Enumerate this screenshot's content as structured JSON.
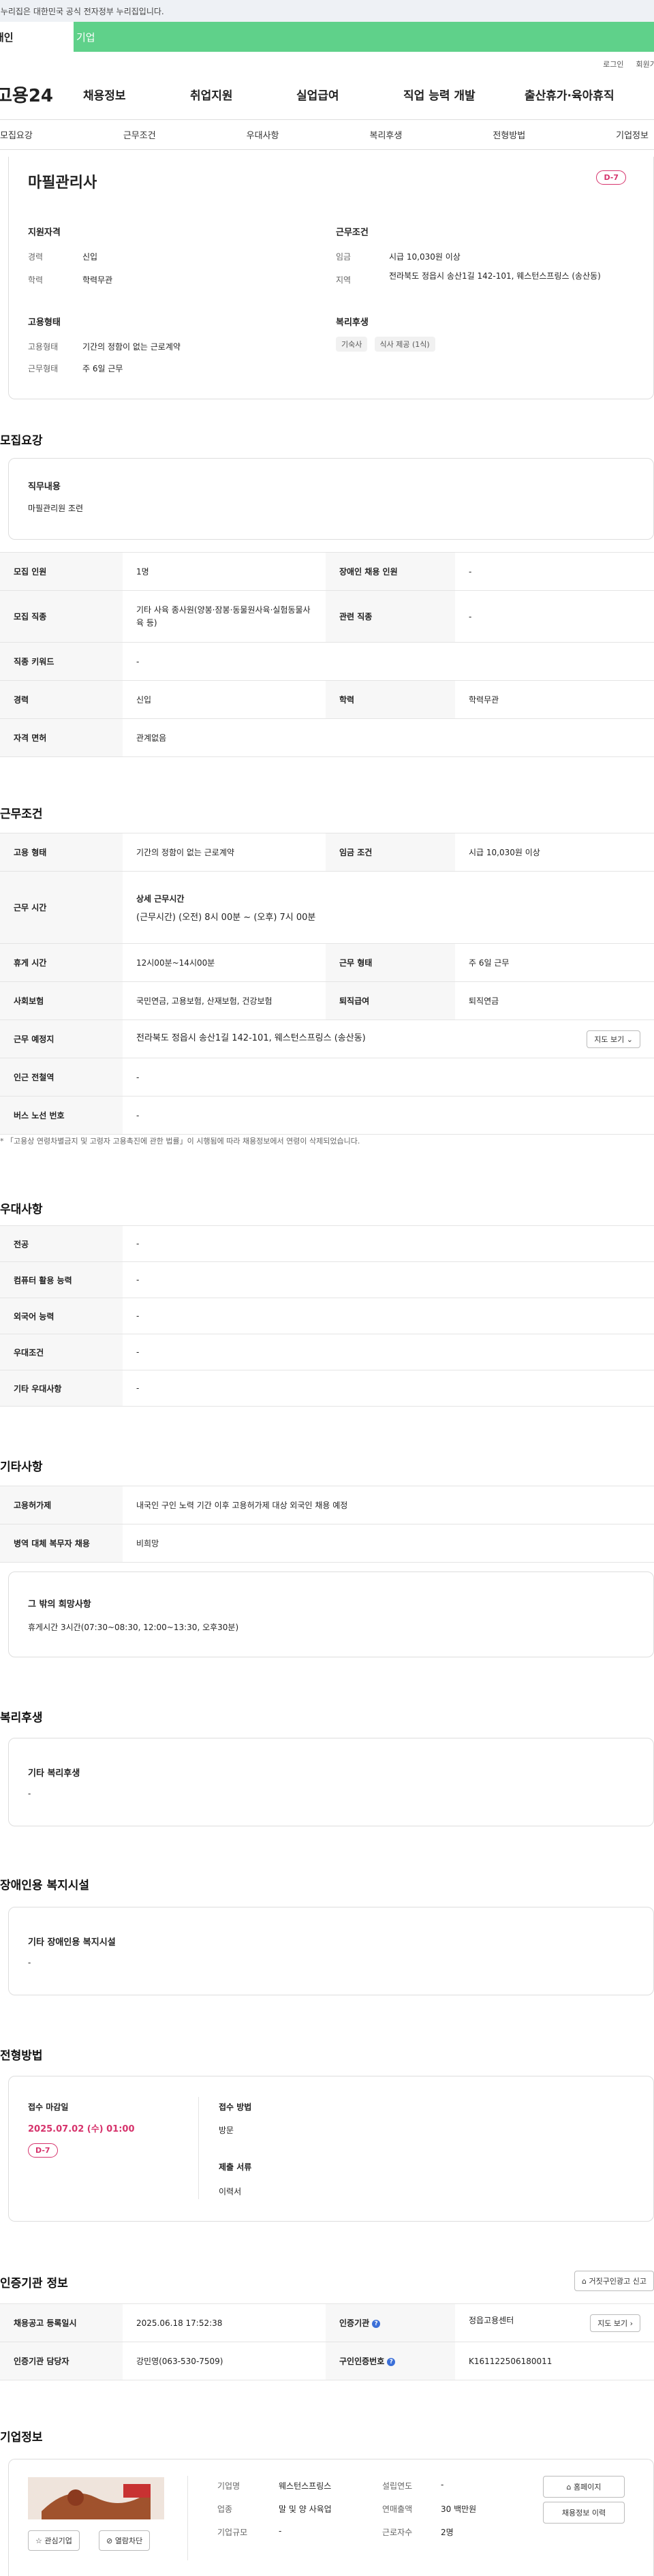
{
  "gov_notice": "이 누리집은 대한민국 공식 전자정부 누리집입니다.",
  "top_tabs": {
    "individual": "개인",
    "corporate": "기업"
  },
  "util": {
    "login": "로그인",
    "join": "회원가입"
  },
  "gnb": {
    "logo": "고용24",
    "menus": [
      "채용정보",
      "취업지원",
      "실업급여",
      "직업 능력 개발",
      "출산휴가·육아휴직"
    ]
  },
  "subnav": [
    "모집요강",
    "근무조건",
    "우대사항",
    "복리후생",
    "전형방법",
    "기업정보"
  ],
  "summary": {
    "title": "마필관리사",
    "dday": "D-7",
    "qualification_title": "지원자격",
    "career_label": "경력",
    "career_value": "신입",
    "education_label": "학력",
    "education_value": "학력무관",
    "employment_title": "고용형태",
    "emp_type_label": "고용형태",
    "emp_type_value": "기간의 정함이 없는 근로계약",
    "work_type_label": "근무형태",
    "work_type_value": "주 6일 근무",
    "conditions_title": "근무조건",
    "wage_label": "임금",
    "wage_value": "시급 10,030원 이상",
    "region_label": "지역",
    "region_value": "전라북도 정읍시 송산1길 142-101, 웨스턴스프링스 (송산동)",
    "welfare_title": "복리후생",
    "welfare_chips": [
      "기숙사",
      "식사 제공 (1식)"
    ]
  },
  "recruit": {
    "title": "모집요강",
    "duty_label": "직무내용",
    "duty_value": "마필관리원 조련",
    "rows": [
      {
        "l1": "모집 인원",
        "v1": "1명",
        "l2": "장애인 채용 인원",
        "v2": "-"
      },
      {
        "l1": "모집 직종",
        "v1": "기타 사육 종사원(양봉·잠봉·동물원사육·실험동물사육 등)",
        "l2": "관련 직종",
        "v2": "-"
      },
      {
        "l1": "직종 키워드",
        "v1": "-",
        "l2": "",
        "v2": ""
      },
      {
        "l1": "경력",
        "v1": "신입",
        "l2": "학력",
        "v2": "학력무관"
      },
      {
        "l1": "자격 면허",
        "v1": "관계없음",
        "l2": "",
        "v2": ""
      }
    ]
  },
  "work": {
    "title": "근무조건",
    "emp_label": "고용 형태",
    "emp_value": "기간의 정함이 없는 근로계약",
    "wage_label": "임금 조건",
    "wage_value": "시급 10,030원 이상",
    "time_label": "근무 시간",
    "time_sub": "상세 근무시간",
    "time_value": "(근무시간) (오전) 8시 00분 ~ (오후) 7시 00분",
    "rest_label": "휴게 시간",
    "rest_value": "12시00분~14시00분",
    "type_label": "근무 형태",
    "type_value": "주 6일 근무",
    "ins_label": "사회보험",
    "ins_value": "국민연금, 고용보험, 산재보험, 건강보험",
    "sev_label": "퇴직급여",
    "sev_value": "퇴직연금",
    "place_label": "근무 예정지",
    "place_value": "전라북도 정읍시 송산1길 142-101, 웨스턴스프링스 (송산동)",
    "map_button": "지도 보기",
    "subway_label": "인근 전철역",
    "subway_value": "-",
    "bus_label": "버스 노선 번호",
    "bus_value": "-",
    "note": "「고용상 연령차별금지 및 고령자 고용촉진에 관한 법률」이 시행됨에 따라 채용정보에서 연령이 삭제되었습니다."
  },
  "pref": {
    "title": "우대사항",
    "rows": [
      {
        "label": "전공",
        "value": "-"
      },
      {
        "label": "컴퓨터 활용 능력",
        "value": "-"
      },
      {
        "label": "외국어 능력",
        "value": "-"
      },
      {
        "label": "우대조건",
        "value": "-"
      },
      {
        "label": "기타 우대사항",
        "value": "-"
      }
    ]
  },
  "etc": {
    "title": "기타사항",
    "rows": [
      {
        "label": "고용허가제",
        "value": "내국인 구인 노력 기간 이후 고용허가제 대상 외국인 채용 예정"
      },
      {
        "label": "병역 대체 복무자 채용",
        "value": "비희망"
      }
    ],
    "wish_title": "그 밖의 희망사항",
    "wish_value": "휴게시간 3시간(07:30~08:30, 12:00~13:30, 오후30분)"
  },
  "welfare": {
    "title": "복리후생",
    "sub": "기타 복리후생",
    "value": "-"
  },
  "disabled": {
    "title": "장애인용 복지시설",
    "sub": "기타 장애인용 복지시설",
    "value": "-"
  },
  "process": {
    "title": "전형방법",
    "deadline_label": "접수 마감일",
    "deadline_value": "2025.07.02 (수) 01:00",
    "dday": "D-7",
    "method_label": "접수 방법",
    "method_value": "방문",
    "docs_label": "제출 서류",
    "docs_value": "이력서"
  },
  "agency": {
    "title": "인증기관 정보",
    "report_button": "거짓구인광고 신고",
    "reg_label": "채용공고 등록일시",
    "reg_value": "2025.06.18 17:52:38",
    "agency_label": "인증기관",
    "agency_value": "정읍고용센터",
    "map_button": "지도 보기",
    "manager_label": "인증기관 담당자",
    "manager_value": "강민영(063-530-7509)",
    "cert_label": "구인인증번호",
    "cert_value": "K161122506180011"
  },
  "company": {
    "title": "기업정보",
    "interest_button": "관심기업",
    "block_button": "열람차단",
    "name_label": "기업명",
    "name_value": "웨스턴스프링스",
    "year_label": "설립연도",
    "year_value": "-",
    "industry_label": "업종",
    "industry_value": "말 및 양 사육업",
    "sales_label": "연매출액",
    "sales_value": "30 백만원",
    "scale_label": "기업규모",
    "scale_value": "-",
    "emp_label": "근로자수",
    "emp_value": "2명",
    "homepage_button": "홈페이지",
    "history_button": "채용정보 이력"
  }
}
